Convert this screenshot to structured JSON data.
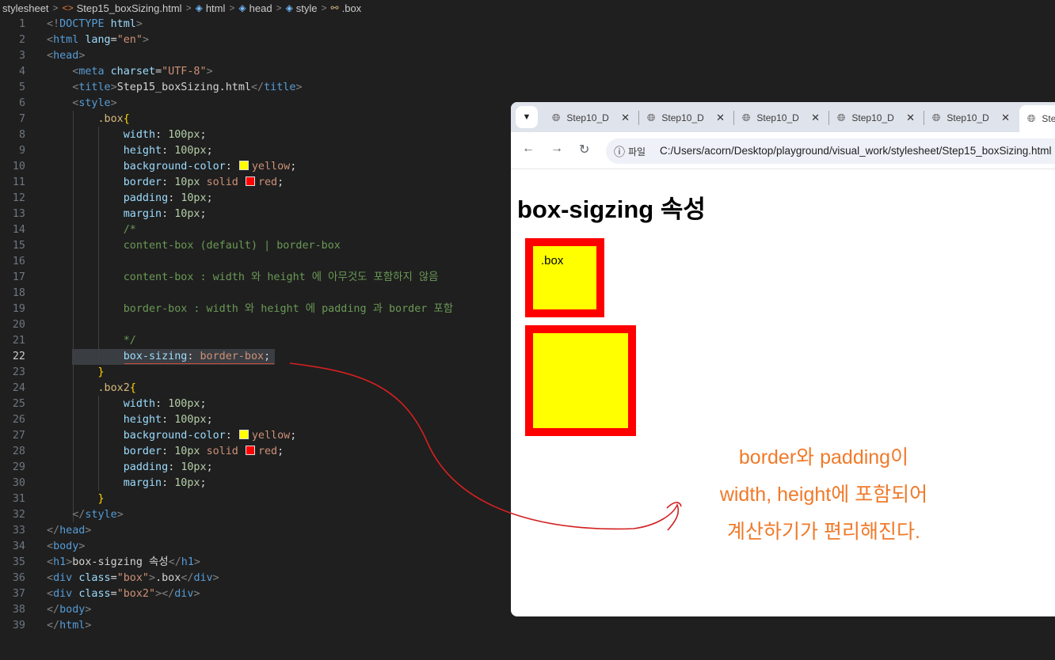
{
  "breadcrumb": {
    "items": [
      "stylesheet",
      "Step15_boxSizing.html",
      "html",
      "head",
      "style",
      ".box"
    ],
    "icons": [
      "none",
      "html-icon",
      "cube-icon",
      "cube-icon",
      "cube-icon",
      "selector-icon"
    ]
  },
  "editor": {
    "active_line": 22,
    "lines": [
      {
        "n": "1",
        "tokens": [
          [
            "br",
            "<!"
          ],
          [
            "tag",
            "DOCTYPE"
          ],
          [
            "txt",
            " "
          ],
          [
            "attr",
            "html"
          ],
          [
            "br",
            ">"
          ]
        ]
      },
      {
        "n": "2",
        "tokens": [
          [
            "br",
            "<"
          ],
          [
            "tag",
            "html"
          ],
          [
            "txt",
            " "
          ],
          [
            "attr",
            "lang"
          ],
          [
            "txt",
            "="
          ],
          [
            "str",
            "\"en\""
          ],
          [
            "br",
            ">"
          ]
        ]
      },
      {
        "n": "3",
        "tokens": [
          [
            "br",
            "<"
          ],
          [
            "tag",
            "head"
          ],
          [
            "br",
            ">"
          ]
        ]
      },
      {
        "n": "4",
        "tokens": [
          [
            "txt",
            "    "
          ],
          [
            "br",
            "<"
          ],
          [
            "tag",
            "meta"
          ],
          [
            "txt",
            " "
          ],
          [
            "attr",
            "charset"
          ],
          [
            "txt",
            "="
          ],
          [
            "str",
            "\"UTF-8\""
          ],
          [
            "br",
            ">"
          ]
        ]
      },
      {
        "n": "5",
        "tokens": [
          [
            "txt",
            "    "
          ],
          [
            "br",
            "<"
          ],
          [
            "tag",
            "title"
          ],
          [
            "br",
            ">"
          ],
          [
            "txt",
            "Step15_boxSizing.html"
          ],
          [
            "br",
            "</"
          ],
          [
            "tag",
            "title"
          ],
          [
            "br",
            ">"
          ]
        ]
      },
      {
        "n": "6",
        "tokens": [
          [
            "txt",
            "    "
          ],
          [
            "br",
            "<"
          ],
          [
            "tag",
            "style"
          ],
          [
            "br",
            ">"
          ]
        ]
      },
      {
        "n": "7",
        "tokens": [
          [
            "txt",
            "        "
          ],
          [
            "sel",
            ".box"
          ],
          [
            "brace",
            "{"
          ]
        ]
      },
      {
        "n": "8",
        "tokens": [
          [
            "txt",
            "            "
          ],
          [
            "prop",
            "width"
          ],
          [
            "txt",
            ": "
          ],
          [
            "num",
            "100px"
          ],
          [
            "txt",
            ";"
          ]
        ]
      },
      {
        "n": "9",
        "tokens": [
          [
            "txt",
            "            "
          ],
          [
            "prop",
            "height"
          ],
          [
            "txt",
            ": "
          ],
          [
            "num",
            "100px"
          ],
          [
            "txt",
            ";"
          ]
        ]
      },
      {
        "n": "10",
        "tokens": [
          [
            "txt",
            "            "
          ],
          [
            "prop",
            "background-color"
          ],
          [
            "txt",
            ": "
          ],
          [
            "sw",
            "#ffff00"
          ],
          [
            "val",
            "yellow"
          ],
          [
            "txt",
            ";"
          ]
        ]
      },
      {
        "n": "11",
        "tokens": [
          [
            "txt",
            "            "
          ],
          [
            "prop",
            "border"
          ],
          [
            "txt",
            ": "
          ],
          [
            "num",
            "10px"
          ],
          [
            "txt",
            " "
          ],
          [
            "val",
            "solid"
          ],
          [
            "txt",
            " "
          ],
          [
            "sw",
            "#ff0000"
          ],
          [
            "val",
            "red"
          ],
          [
            "txt",
            ";"
          ]
        ]
      },
      {
        "n": "12",
        "tokens": [
          [
            "txt",
            "            "
          ],
          [
            "prop",
            "padding"
          ],
          [
            "txt",
            ": "
          ],
          [
            "num",
            "10px"
          ],
          [
            "txt",
            ";"
          ]
        ]
      },
      {
        "n": "13",
        "tokens": [
          [
            "txt",
            "            "
          ],
          [
            "prop",
            "margin"
          ],
          [
            "txt",
            ": "
          ],
          [
            "num",
            "10px"
          ],
          [
            "txt",
            ";"
          ]
        ]
      },
      {
        "n": "14",
        "tokens": [
          [
            "txt",
            "            "
          ],
          [
            "com",
            "/*"
          ]
        ]
      },
      {
        "n": "15",
        "tokens": [
          [
            "txt",
            "            "
          ],
          [
            "com",
            "content-box (default) | border-box"
          ]
        ]
      },
      {
        "n": "16",
        "tokens": []
      },
      {
        "n": "17",
        "tokens": [
          [
            "txt",
            "            "
          ],
          [
            "com",
            "content-box : width 와 height 에 아무것도 포함하지 않음"
          ]
        ]
      },
      {
        "n": "18",
        "tokens": []
      },
      {
        "n": "19",
        "tokens": [
          [
            "txt",
            "            "
          ],
          [
            "com",
            "border-box : width 와 height 에 padding 과 border 포함"
          ]
        ]
      },
      {
        "n": "20",
        "tokens": []
      },
      {
        "n": "21",
        "tokens": [
          [
            "txt",
            "            "
          ],
          [
            "com",
            "*/"
          ]
        ]
      },
      {
        "n": "22",
        "tokens": [
          [
            "txt",
            "            "
          ],
          [
            "prop",
            "box-sizing"
          ],
          [
            "txt",
            ": "
          ],
          [
            "val",
            "border-box"
          ],
          [
            "txt",
            ";"
          ]
        ]
      },
      {
        "n": "23",
        "tokens": [
          [
            "txt",
            "        "
          ],
          [
            "brace",
            "}"
          ]
        ]
      },
      {
        "n": "24",
        "tokens": [
          [
            "txt",
            "        "
          ],
          [
            "sel",
            ".box2"
          ],
          [
            "brace",
            "{"
          ]
        ]
      },
      {
        "n": "25",
        "tokens": [
          [
            "txt",
            "            "
          ],
          [
            "prop",
            "width"
          ],
          [
            "txt",
            ": "
          ],
          [
            "num",
            "100px"
          ],
          [
            "txt",
            ";"
          ]
        ]
      },
      {
        "n": "26",
        "tokens": [
          [
            "txt",
            "            "
          ],
          [
            "prop",
            "height"
          ],
          [
            "txt",
            ": "
          ],
          [
            "num",
            "100px"
          ],
          [
            "txt",
            ";"
          ]
        ]
      },
      {
        "n": "27",
        "tokens": [
          [
            "txt",
            "            "
          ],
          [
            "prop",
            "background-color"
          ],
          [
            "txt",
            ": "
          ],
          [
            "sw",
            "#ffff00"
          ],
          [
            "val",
            "yellow"
          ],
          [
            "txt",
            ";"
          ]
        ]
      },
      {
        "n": "28",
        "tokens": [
          [
            "txt",
            "            "
          ],
          [
            "prop",
            "border"
          ],
          [
            "txt",
            ": "
          ],
          [
            "num",
            "10px"
          ],
          [
            "txt",
            " "
          ],
          [
            "val",
            "solid"
          ],
          [
            "txt",
            " "
          ],
          [
            "sw",
            "#ff0000"
          ],
          [
            "val",
            "red"
          ],
          [
            "txt",
            ";"
          ]
        ]
      },
      {
        "n": "29",
        "tokens": [
          [
            "txt",
            "            "
          ],
          [
            "prop",
            "padding"
          ],
          [
            "txt",
            ": "
          ],
          [
            "num",
            "10px"
          ],
          [
            "txt",
            ";"
          ]
        ]
      },
      {
        "n": "30",
        "tokens": [
          [
            "txt",
            "            "
          ],
          [
            "prop",
            "margin"
          ],
          [
            "txt",
            ": "
          ],
          [
            "num",
            "10px"
          ],
          [
            "txt",
            ";"
          ]
        ]
      },
      {
        "n": "31",
        "tokens": [
          [
            "txt",
            "        "
          ],
          [
            "brace",
            "}"
          ]
        ]
      },
      {
        "n": "32",
        "tokens": [
          [
            "txt",
            "    "
          ],
          [
            "br",
            "</"
          ],
          [
            "tag",
            "style"
          ],
          [
            "br",
            ">"
          ]
        ]
      },
      {
        "n": "33",
        "tokens": [
          [
            "br",
            "</"
          ],
          [
            "tag",
            "head"
          ],
          [
            "br",
            ">"
          ]
        ]
      },
      {
        "n": "34",
        "tokens": [
          [
            "br",
            "<"
          ],
          [
            "tag",
            "body"
          ],
          [
            "br",
            ">"
          ]
        ]
      },
      {
        "n": "35",
        "tokens": [
          [
            "br",
            "<"
          ],
          [
            "tag",
            "h1"
          ],
          [
            "br",
            ">"
          ],
          [
            "txt",
            "box-sigzing 속성"
          ],
          [
            "br",
            "</"
          ],
          [
            "tag",
            "h1"
          ],
          [
            "br",
            ">"
          ]
        ]
      },
      {
        "n": "36",
        "tokens": [
          [
            "br",
            "<"
          ],
          [
            "tag",
            "div"
          ],
          [
            "txt",
            " "
          ],
          [
            "attr",
            "class"
          ],
          [
            "txt",
            "="
          ],
          [
            "str",
            "\"box\""
          ],
          [
            "br",
            ">"
          ],
          [
            "txt",
            ".box"
          ],
          [
            "br",
            "</"
          ],
          [
            "tag",
            "div"
          ],
          [
            "br",
            ">"
          ]
        ]
      },
      {
        "n": "37",
        "tokens": [
          [
            "br",
            "<"
          ],
          [
            "tag",
            "div"
          ],
          [
            "txt",
            " "
          ],
          [
            "attr",
            "class"
          ],
          [
            "txt",
            "="
          ],
          [
            "str",
            "\"box2\""
          ],
          [
            "br",
            "></"
          ],
          [
            "tag",
            "div"
          ],
          [
            "br",
            ">"
          ]
        ]
      },
      {
        "n": "38",
        "tokens": [
          [
            "br",
            "</"
          ],
          [
            "tag",
            "body"
          ],
          [
            "br",
            ">"
          ]
        ]
      },
      {
        "n": "39",
        "tokens": [
          [
            "br",
            "</"
          ],
          [
            "tag",
            "html"
          ],
          [
            "br",
            ">"
          ]
        ]
      }
    ]
  },
  "browser": {
    "tabs": [
      "Step10_D",
      "Step10_D",
      "Step10_D",
      "Step10_D",
      "Step10_D",
      "Ste"
    ],
    "chip_label": "파일",
    "url": "C:/Users/acorn/Desktop/playground/visual_work/stylesheet/Step15_boxSizing.html",
    "page": {
      "heading": "box-sigzing 속성",
      "box_text": ".box"
    }
  },
  "annotation": {
    "lines": [
      "border와 padding이",
      "width, height에 포함되어",
      "계산하기가 편리해진다."
    ],
    "color": "#f07a2a",
    "arrow_color": "#d42020"
  }
}
